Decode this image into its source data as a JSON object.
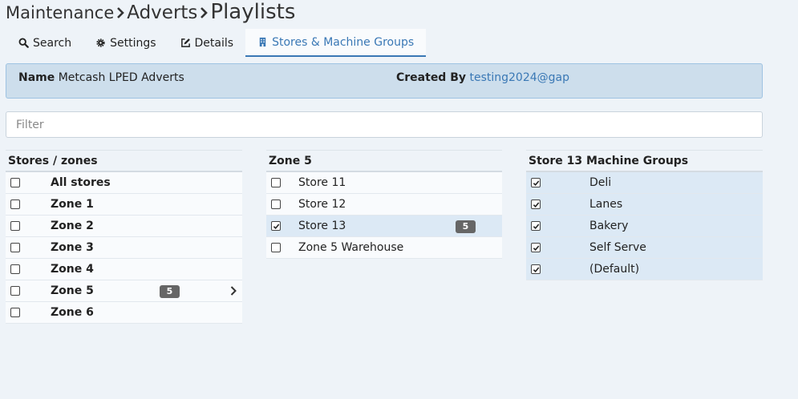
{
  "breadcrumb": [
    {
      "label": "Maintenance"
    },
    {
      "label": "Adverts"
    },
    {
      "label": "Playlists"
    }
  ],
  "tabs": [
    {
      "label": "Search",
      "icon": "search-icon",
      "active": false
    },
    {
      "label": "Settings",
      "icon": "gear-icon",
      "active": false
    },
    {
      "label": "Details",
      "icon": "edit-icon",
      "active": false
    },
    {
      "label": "Stores & Machine Groups",
      "icon": "building-icon",
      "active": true
    }
  ],
  "info": {
    "name_label": "Name",
    "name_value": "Metcash LPED Adverts",
    "created_label": "Created By",
    "created_value": "testing2024@gap"
  },
  "filter": {
    "placeholder": "Filter",
    "value": ""
  },
  "zones_panel": {
    "header": "Stores / zones",
    "rows": [
      {
        "label": "All stores",
        "checked": false,
        "badge": "",
        "expandable": false
      },
      {
        "label": "Zone 1",
        "checked": false,
        "badge": "",
        "expandable": false
      },
      {
        "label": "Zone 2",
        "checked": false,
        "badge": "",
        "expandable": false
      },
      {
        "label": "Zone 3",
        "checked": false,
        "badge": "",
        "expandable": false
      },
      {
        "label": "Zone 4",
        "checked": false,
        "badge": "",
        "expandable": false
      },
      {
        "label": "Zone 5",
        "checked": false,
        "badge": "5",
        "expandable": true
      },
      {
        "label": "Zone 6",
        "checked": false,
        "badge": "",
        "expandable": false
      }
    ]
  },
  "stores_panel": {
    "header": "Zone 5",
    "rows": [
      {
        "label": "Store 11",
        "checked": false,
        "badge": "",
        "selected": false
      },
      {
        "label": "Store 12",
        "checked": false,
        "badge": "",
        "selected": false
      },
      {
        "label": "Store 13",
        "checked": true,
        "badge": "5",
        "selected": true
      },
      {
        "label": "Zone 5 Warehouse",
        "checked": false,
        "badge": "",
        "selected": false
      }
    ]
  },
  "groups_panel": {
    "header": "Store 13 Machine Groups",
    "rows": [
      {
        "label": "Deli",
        "checked": true
      },
      {
        "label": "Lanes",
        "checked": true
      },
      {
        "label": "Bakery",
        "checked": true
      },
      {
        "label": "Self Serve",
        "checked": true
      },
      {
        "label": "(Default)",
        "checked": true
      }
    ]
  },
  "colors": {
    "accent": "#3a78b5",
    "info_bg": "#cddeec",
    "selected_row": "#dce9f5",
    "badge": "#666666"
  }
}
